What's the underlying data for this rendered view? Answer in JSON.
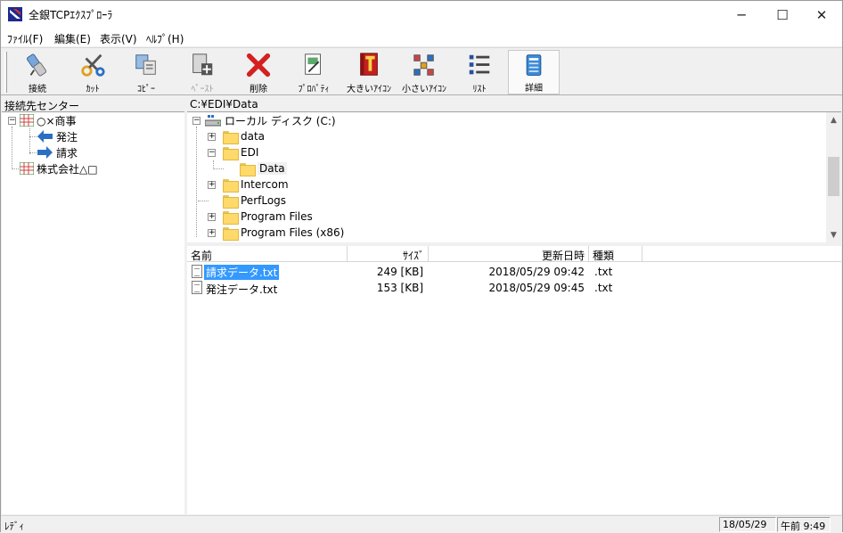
{
  "window": {
    "title": "全銀TCPｴｸｽﾌﾟﾛｰﾗ",
    "minimize": "─",
    "maximize": "☐",
    "close": "✕"
  },
  "menu": [
    {
      "label": "ﾌｧｲﾙ(F)"
    },
    {
      "label": "編集(E)"
    },
    {
      "label": "表示(V)"
    },
    {
      "label": "ﾍﾙﾌﾟ(H)"
    }
  ],
  "toolbar": {
    "connect": "接続",
    "cut": "ｶｯﾄ",
    "copy": "ｺﾋﾟｰ",
    "paste": "ﾍﾟｰｽﾄ",
    "delete": "削除",
    "properties": "ﾌﾟﾛﾊﾟﾃｨ",
    "large_icons": "大きいｱｲｺﾝ",
    "small_icons": "小さいｱｲｺﾝ",
    "list": "ﾘｽﾄ",
    "details": "詳細"
  },
  "left_pane": {
    "header": "接続先センター",
    "tree": [
      {
        "label": "○×商事"
      },
      {
        "label": "発注"
      },
      {
        "label": "請求"
      },
      {
        "label": "株式会社△□"
      }
    ]
  },
  "folder_pane": {
    "path": "C:¥EDI¥Data",
    "drive": "ローカル ディスク (C:)",
    "folders": [
      "data",
      "EDI",
      "Data",
      "Intercom",
      "PerfLogs",
      "Program Files",
      "Program Files (x86)"
    ]
  },
  "file_list": {
    "columns": {
      "name": "名前",
      "size": "ｻｲｽﾞ",
      "date": "更新日時",
      "type": "種類"
    },
    "rows": [
      {
        "name": "請求データ.txt",
        "size": "249 [KB]",
        "date": "2018/05/29  09:42",
        "type": ".txt"
      },
      {
        "name": "発注データ.txt",
        "size": "153 [KB]",
        "date": "2018/05/29  09:45",
        "type": ".txt"
      }
    ]
  },
  "status": {
    "text": "ﾚﾃﾞｨ",
    "date": "18/05/29",
    "time": "午前 9:49"
  },
  "colors": {
    "selection": "#3399ff",
    "arrow_blue": "#2b6fc4"
  }
}
